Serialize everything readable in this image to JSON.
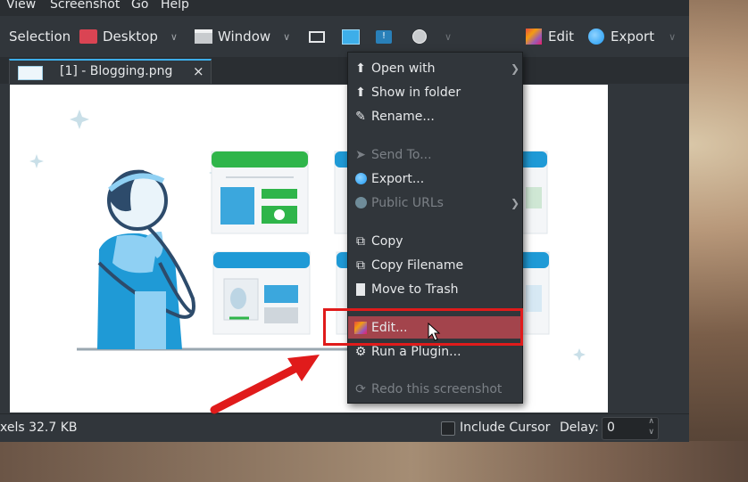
{
  "menubar": {
    "items": [
      "View",
      "Screenshot",
      "Go",
      "Help"
    ]
  },
  "toolbar": {
    "selection": "Selection",
    "desktop": "Desktop",
    "window": "Window",
    "edit": "Edit",
    "export": "Export"
  },
  "tab": {
    "label": "[1] - Blogging.png",
    "close": "×"
  },
  "context_menu": {
    "items": [
      {
        "label": "Open with",
        "icon": "open-with-icon",
        "submenu": true,
        "enabled": true
      },
      {
        "label": "Show in folder",
        "icon": "folder-icon",
        "enabled": true
      },
      {
        "label": "Rename...",
        "icon": "pencil-icon",
        "enabled": true
      },
      {
        "label": "Send To...",
        "icon": "send-icon",
        "enabled": false
      },
      {
        "label": "Export...",
        "icon": "globe-icon",
        "enabled": true
      },
      {
        "label": "Public URLs",
        "icon": "globe-icon",
        "submenu": true,
        "enabled": false
      },
      {
        "label": "Copy",
        "icon": "copy-icon",
        "enabled": true
      },
      {
        "label": "Copy Filename",
        "icon": "copy-icon",
        "enabled": true
      },
      {
        "label": "Move to Trash",
        "icon": "trash-icon",
        "enabled": true
      },
      {
        "label": "Edit...",
        "icon": "palette-icon",
        "enabled": true,
        "highlighted": true
      },
      {
        "label": "Run a Plugin...",
        "icon": "gear-icon",
        "enabled": true
      },
      {
        "label": "Redo this screenshot",
        "icon": "redo-icon",
        "enabled": false
      }
    ]
  },
  "statusbar": {
    "size_text": "xels  32.7 KB",
    "include_cursor": "Include Cursor",
    "delay_label": "Delay:",
    "delay_value": "0"
  },
  "colors": {
    "highlight": "#a3444c",
    "annotation_red": "#e01b1b",
    "accent_blue": "#3daee9"
  }
}
